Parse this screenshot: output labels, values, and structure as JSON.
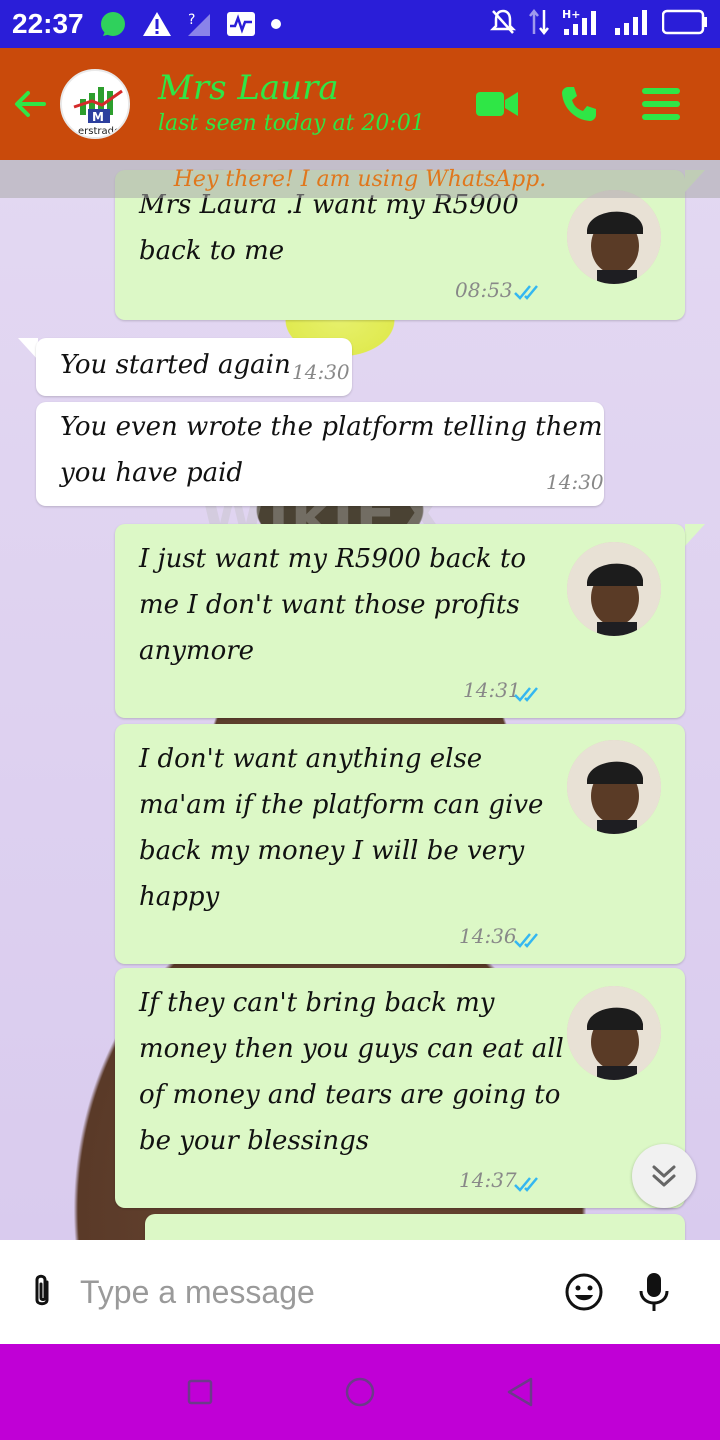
{
  "status_bar": {
    "time": "22:37",
    "left_icons": [
      "whatsapp-icon",
      "warning-icon",
      "no-signal-icon",
      "activity-icon",
      "dot-icon"
    ],
    "right_icons": [
      "mute-icon",
      "data-arrows-icon",
      "signal-h-plus-icon",
      "signal-icon",
      "battery-icon"
    ],
    "network_label": "H+"
  },
  "header": {
    "back_icon": "arrow-left-icon",
    "avatar_logo_text": "erstrade",
    "contact_name": "Mrs Laura",
    "last_seen": "last seen today at 20:01",
    "actions": [
      "video-call-icon",
      "phone-icon",
      "menu-icon"
    ],
    "accent_color": "#c94a0b",
    "title_color": "#2fe646"
  },
  "status_message": "Hey there! I am using WhatsApp.",
  "watermark": "WikiFX",
  "messages": [
    {
      "direction": "out",
      "lines": [
        "Mrs Laura .I want my R5900",
        "back to me"
      ],
      "time": "08:53",
      "read": true
    },
    {
      "direction": "in",
      "lines": [
        "You started again"
      ],
      "time": "14:30"
    },
    {
      "direction": "in",
      "lines": [
        "You even wrote the platform telling them",
        "you have paid"
      ],
      "time": "14:30"
    },
    {
      "direction": "out",
      "lines": [
        "I just want my R5900 back to",
        "me I don't want those profits",
        "anymore"
      ],
      "time": "14:31",
      "read": true
    },
    {
      "direction": "out",
      "lines": [
        "I don't want anything else",
        "ma'am if the platform can give",
        "back my money I will be very",
        "happy"
      ],
      "time": "14:36",
      "read": true
    },
    {
      "direction": "out",
      "lines": [
        "If they can't bring back my",
        "money then you guys can eat all",
        "of money and tears are going to",
        "be your blessings"
      ],
      "time": "14:37",
      "read": true
    }
  ],
  "scroll_down_icon": "chevron-double-down-icon",
  "input": {
    "placeholder": "Type a message",
    "value": "",
    "attach_icon": "paperclip-icon",
    "emoji_icon": "emoji-icon",
    "mic_icon": "microphone-icon"
  },
  "nav_bar": {
    "buttons": [
      "recents-square-icon",
      "home-circle-icon",
      "back-triangle-icon"
    ],
    "color": "#c000d6"
  }
}
